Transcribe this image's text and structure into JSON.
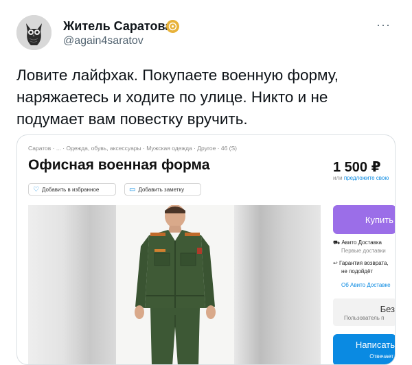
{
  "author": {
    "display_name": "Житель Саратова",
    "handle": "@again4saratov",
    "avatar_icon": "owl-avatar",
    "badge_icon": "verified-badge-icon",
    "badge_color": "#e8b23a"
  },
  "more_label": "···",
  "tweet_text": {
    "line1": "Ловите лайфхак. Покупаете военную форму,",
    "line2": "наряжаетесь и ходите по улице. Никто и не",
    "line3": "подумает вам повестку вручить."
  },
  "listing": {
    "breadcrumbs": "Саратов · ... · Одежда, обувь, аксессуары · Мужская одежда · Другое · 46 (S)",
    "title": "Офисная военная форма",
    "price": "1 500 ₽",
    "price_note_prefix": "или ",
    "price_note_link": "предложите свою",
    "favorite_label": "Добавить в избранное",
    "note_label": "Добавить заметку",
    "buy_label": "Купить",
    "delivery_label": "Авито Доставка",
    "delivery_sub": "Первые доставки",
    "guarantee_line1": "Гарантия возврата,",
    "guarantee_line2": "не подойдёт",
    "about_delivery": "Об Авито Доставке",
    "seller_box_big": "Без",
    "seller_box_small": "Пользователь п",
    "message_label": "Написать",
    "message_sub": "Отвечает",
    "accent_purple": "#9b6ee8",
    "accent_blue": "#0a8ae2"
  }
}
